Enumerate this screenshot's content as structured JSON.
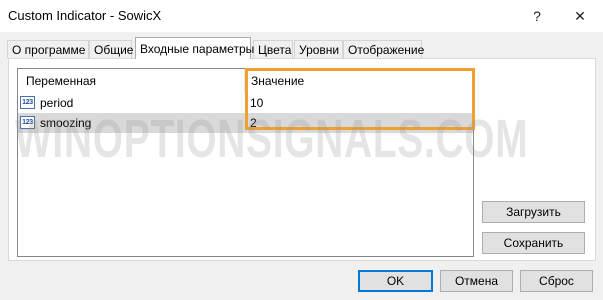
{
  "window": {
    "title": "Custom Indicator - SowicX",
    "help_glyph": "?",
    "close_glyph": "✕"
  },
  "tabs": [
    {
      "label": "О программе"
    },
    {
      "label": "Общие"
    },
    {
      "label": "Входные параметры"
    },
    {
      "label": "Цвета"
    },
    {
      "label": "Уровни"
    },
    {
      "label": "Отображение"
    }
  ],
  "active_tab": "Входные параметры",
  "table": {
    "columns": [
      "Переменная",
      "Значение"
    ],
    "rows": [
      {
        "icon": "integer-param-icon",
        "icon_text": "123",
        "name": "period",
        "value": "10",
        "selected": false
      },
      {
        "icon": "integer-param-icon",
        "icon_text": "123",
        "name": "smoozing",
        "value": "2",
        "selected": true
      }
    ]
  },
  "watermark": "WINOPTIONSIGNALS.COM",
  "side_buttons": {
    "load": "Загрузить",
    "save": "Сохранить"
  },
  "footer_buttons": {
    "ok": "OK",
    "cancel": "Отмена",
    "reset": "Сброс"
  },
  "colors": {
    "highlight": "#f0a030",
    "default_button_border": "#0078d7"
  }
}
